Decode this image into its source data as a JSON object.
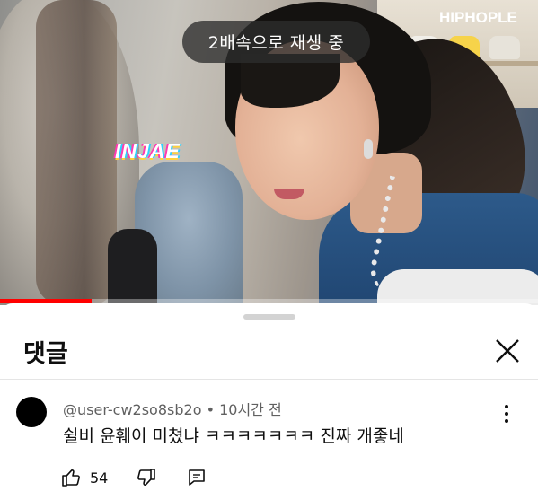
{
  "video": {
    "speed_status": "2배속으로 재생 중",
    "channel_logo": "HIPHOPLE",
    "name_tag": "INJAE",
    "progress_fraction": 0.17,
    "progress_color": "#ff0000"
  },
  "comments_panel": {
    "title": "댓글",
    "close_icon": "close-icon"
  },
  "comment": {
    "author": "@user-cw2so8sb2o",
    "separator": " • ",
    "time": "10시간 전",
    "text": "쉴비 윤훼이 미쳤냐 ㅋㅋㅋㅋㅋㅋㅋ 진짜 개좋네",
    "like_count": "54",
    "icons": [
      "thumbs-up-icon",
      "thumbs-down-icon",
      "reply-icon",
      "more-vert-icon"
    ]
  }
}
